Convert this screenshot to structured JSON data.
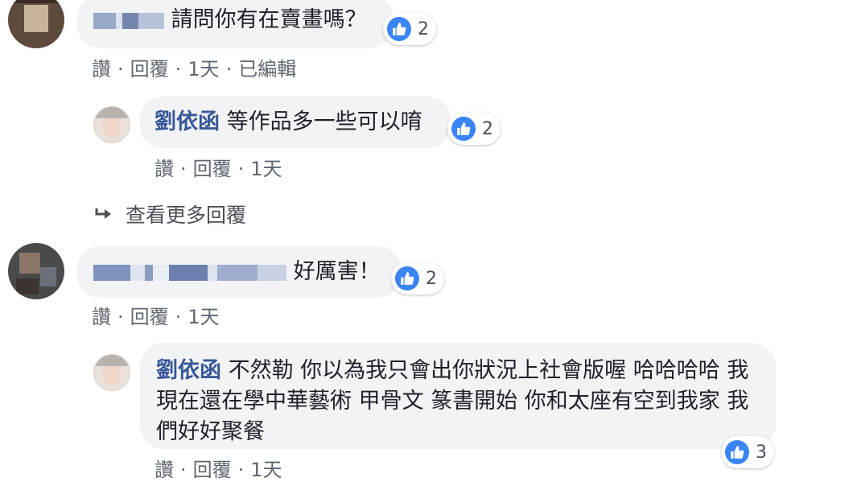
{
  "comments": [
    {
      "author_blurred": true,
      "text": "請問你有在賣畫嗎？",
      "reaction": {
        "icon": "like-icon",
        "count": "2"
      },
      "actions": {
        "like": "讚",
        "reply": "回覆",
        "time": "1天",
        "edited": "已編輯"
      },
      "reply": {
        "author": "劉依函",
        "text": "等作品多一些可以唷",
        "reaction": {
          "icon": "like-icon",
          "count": "2"
        },
        "actions": {
          "like": "讚",
          "reply": "回覆",
          "time": "1天"
        }
      },
      "more_replies": {
        "icon": "reply-arrow-icon",
        "label": "查看更多回覆"
      }
    },
    {
      "author_blurred": true,
      "text": "好厲害！",
      "reaction": {
        "icon": "like-icon",
        "count": "2"
      },
      "actions": {
        "like": "讚",
        "reply": "回覆",
        "time": "1天"
      },
      "reply": {
        "author": "劉依函",
        "text": "不然勒 你以為我只會出你狀況上社會版喔 哈哈哈哈 我現在還在學中華藝術 甲骨文 篆書開始 你和太座有空到我家 我們好好聚餐",
        "reaction": {
          "icon": "like-icon",
          "count": "3"
        },
        "actions": {
          "like": "讚",
          "reply": "回覆",
          "time": "1天"
        }
      }
    }
  ],
  "colors": {
    "accent": "#385898",
    "like": "#3a84f6",
    "bubble": "#f2f3f5"
  }
}
